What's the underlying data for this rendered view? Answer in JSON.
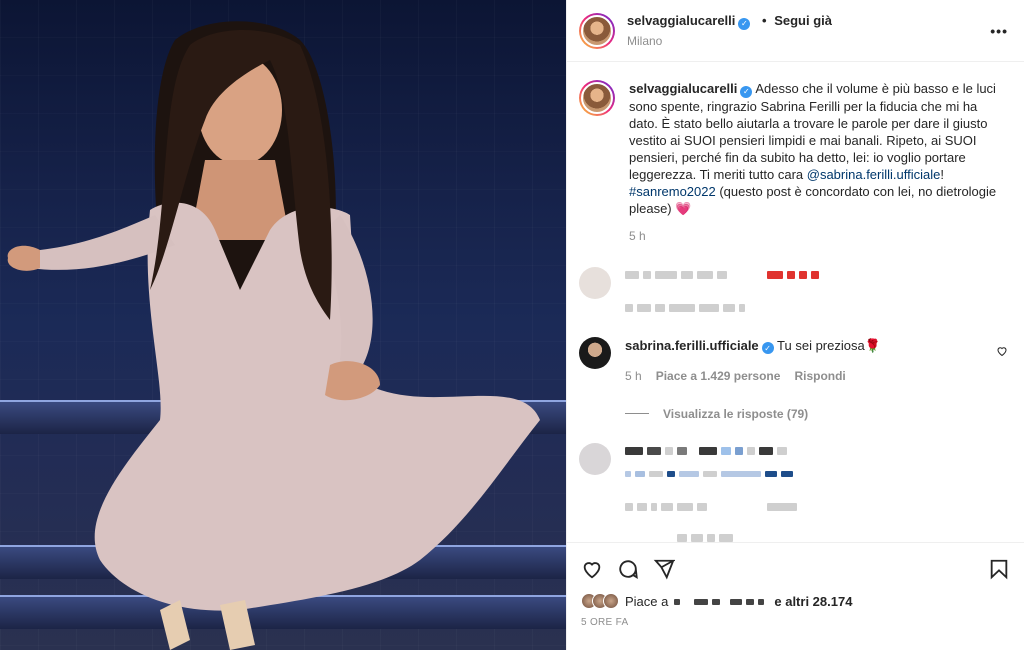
{
  "post": {
    "photo_alt": "Sabrina Ferilli seduta sul palco di Sanremo 2022",
    "author": "selvaggialucarelli",
    "follow_label": "Segui già",
    "location": "Milano",
    "more_label": "•••"
  },
  "caption": {
    "author": "selvaggialucarelli",
    "text_before_mention": "Adesso che il volume è più basso e le luci sono spente, ringrazio Sabrina Ferilli per la fiducia che mi ha dato. È stato bello aiutarla a trovare le parole per dare il giusto vestito ai SUOI pensieri limpidi e mai banali. Ripeto, ai SUOI pensieri, perché fin da subito ha detto, lei: io voglio portare leggerezza. Ti meriti tutto cara ",
    "mention": "@sabrina.ferilli.ufficiale",
    "after_mention": "! ",
    "hashtag": "#sanremo2022",
    "after_hashtag": " (questo post è concordato con lei, no dietrologie please) 💗",
    "time": "5 h"
  },
  "reply": {
    "author": "sabrina.ferilli.ufficiale",
    "text": "Tu sei preziosa🌹",
    "time": "5 h",
    "likes": "Piace a 1.429 persone",
    "reply_label": "Rispondi",
    "view_replies": "Visualizza le risposte (79)"
  },
  "footer": {
    "likes_prefix": "Piace a",
    "likes_suffix": "e altri 28.174",
    "timestamp": "5 ORE FA"
  },
  "colors": {
    "link": "#00376b",
    "verified": "#3897f0",
    "blurred_red": "#e0332f"
  }
}
